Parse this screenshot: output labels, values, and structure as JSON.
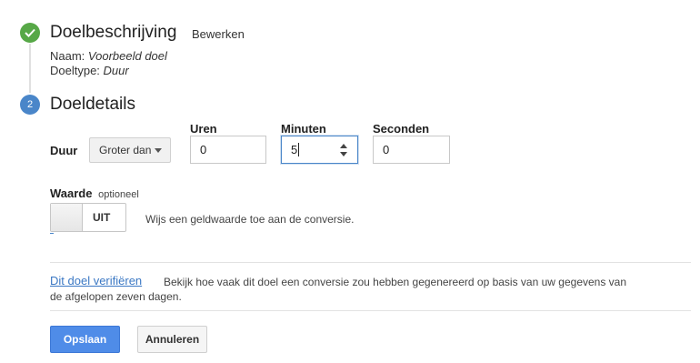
{
  "step1": {
    "title": "Doelbeschrijving",
    "edit_label": "Bewerken",
    "name_label": "Naam:",
    "name_value": "Voorbeeld doel",
    "type_label": "Doeltype:",
    "type_value": "Duur",
    "status_icon": "checkmark-icon"
  },
  "step2": {
    "number": "2",
    "title": "Doeldetails"
  },
  "duration": {
    "label": "Duur",
    "condition_selected": "Groter dan",
    "hours_label": "Uren",
    "hours_value": "0",
    "minutes_label": "Minuten",
    "minutes_value": "5",
    "seconds_label": "Seconden",
    "seconds_value": "0"
  },
  "value": {
    "label": "Waarde",
    "optional": "optioneel",
    "toggle_state": "UIT",
    "help": "Wijs een geldwaarde toe aan de conversie."
  },
  "verify": {
    "link": "Dit doel verifiëren",
    "description": "Bekijk hoe vaak dit doel een conversie zou hebben gegenereerd op basis van uw gegevens van de afgelopen zeven dagen."
  },
  "actions": {
    "save": "Opslaan",
    "cancel": "Annuleren"
  },
  "colors": {
    "success": "#57a847",
    "step": "#4a86c9",
    "primary": "#4f8ce8",
    "link": "#3b78c4"
  }
}
